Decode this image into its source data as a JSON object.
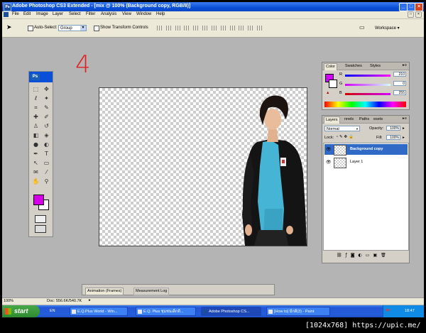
{
  "window": {
    "title": "Adobe Photoshop CS3 Extended - [mix @ 100% (Background copy, RGB/8)]"
  },
  "menu": [
    "File",
    "Edit",
    "Image",
    "Layer",
    "Select",
    "Filter",
    "Analysis",
    "View",
    "Window",
    "Help"
  ],
  "options": {
    "auto_select_label": "Auto-Select:",
    "auto_select_value": "Group",
    "show_transform_label": "Show Transform Controls",
    "workspace_label": "Workspace"
  },
  "annotation": "4",
  "color_panel": {
    "tabs": [
      "Color",
      "Swatches",
      "Styles"
    ],
    "channels": [
      {
        "label": "R",
        "value": "210"
      },
      {
        "label": "G",
        "value": "0"
      },
      {
        "label": "B",
        "value": "255"
      }
    ],
    "foreground_color": "#d200ff"
  },
  "layers_panel": {
    "tabs": [
      "Layers",
      "nnels",
      "Paths",
      "esets"
    ],
    "blend_mode": "Normal",
    "opacity_label": "Opacity:",
    "opacity_value": "100%",
    "lock_label": "Lock:",
    "fill_label": "Fill:",
    "fill_value": "100%",
    "layers": [
      {
        "name": "Background copy",
        "selected": true
      },
      {
        "name": "Layer 1",
        "selected": false
      }
    ]
  },
  "status": {
    "zoom": "100%",
    "doc": "Doc: 556.6K/540.7K"
  },
  "animation_panel": {
    "tabs": [
      "Animation (Frames)",
      "Measurement Log"
    ]
  },
  "taskbar": {
    "start_label": "start",
    "tasks": [
      "E.Q.Plus World - Win...",
      "E.Q. Plus ชุมชนเด็กดี...",
      "Adobe Photoshop CS...",
      "[How to] มีกดี(3) - Paint"
    ],
    "language": "EN",
    "clock": "18:47"
  },
  "watermark": "[1024x768] https://upic.me/"
}
